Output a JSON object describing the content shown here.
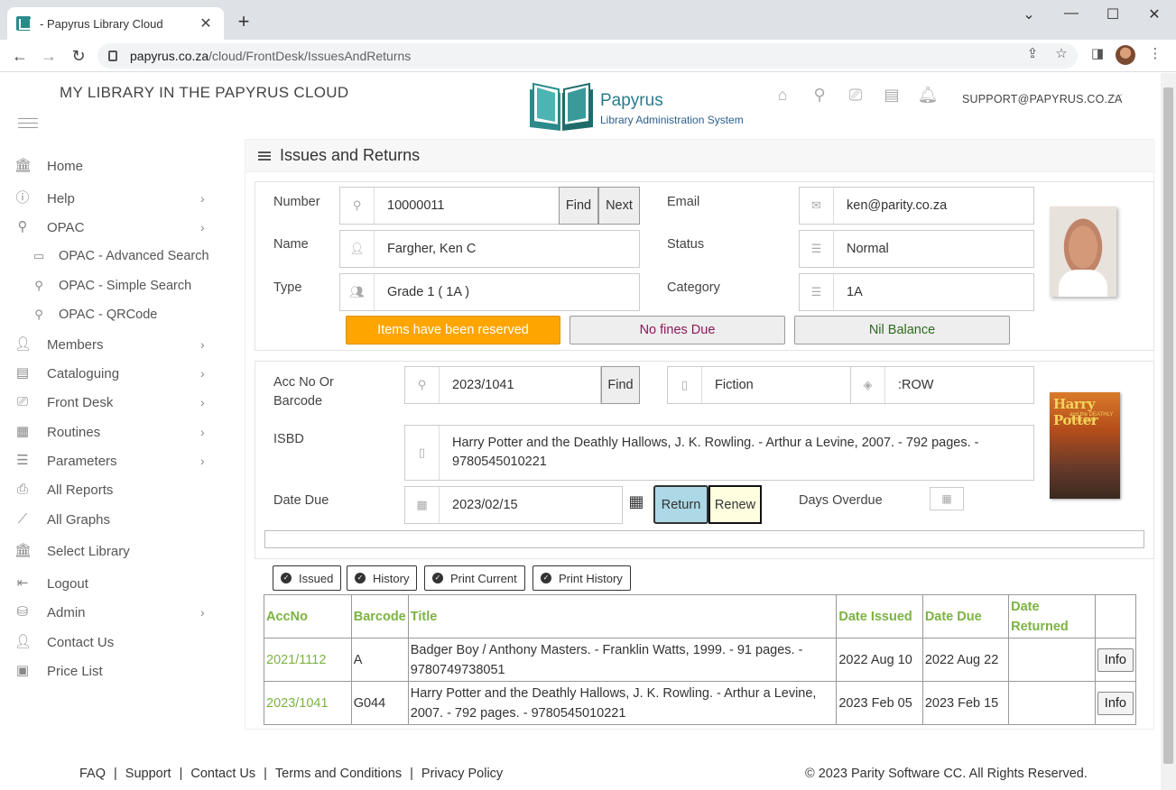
{
  "browser": {
    "tab_title": "- Papyrus Library Cloud",
    "url_host": "papyrus.co.za",
    "url_path": "/cloud/FrontDesk/IssuesAndReturns"
  },
  "header": {
    "site_title": "MY LIBRARY IN THE PAPYRUS CLOUD",
    "logo_name": "Papyrus",
    "logo_tagline": "Library Administration System",
    "user_email": "SUPPORT@PAPYRUS.CO.ZA"
  },
  "sidebar": {
    "items": [
      {
        "label": "Home",
        "icon": "bank-icon"
      },
      {
        "label": "Help",
        "icon": "info-icon"
      },
      {
        "label": "OPAC",
        "icon": "search-icon"
      },
      {
        "label": "OPAC - Advanced Search",
        "icon": "monitor-icon"
      },
      {
        "label": "OPAC - Simple Search",
        "icon": "search-icon"
      },
      {
        "label": "OPAC - QRCode",
        "icon": "search-icon"
      },
      {
        "label": "Members",
        "icon": "users-icon"
      },
      {
        "label": "Cataloguing",
        "icon": "book-icon"
      },
      {
        "label": "Front Desk",
        "icon": "desk-icon"
      },
      {
        "label": "Routines",
        "icon": "calendar-icon"
      },
      {
        "label": "Parameters",
        "icon": "list-icon"
      },
      {
        "label": "All Reports",
        "icon": "printer-icon"
      },
      {
        "label": "All Graphs",
        "icon": "graph-icon"
      },
      {
        "label": "Select Library",
        "icon": "bank-icon"
      },
      {
        "label": "Logout",
        "icon": "logout-icon"
      },
      {
        "label": "Admin",
        "icon": "database-icon"
      },
      {
        "label": "Contact Us",
        "icon": "user-icon"
      },
      {
        "label": "Price List",
        "icon": "wallet-icon"
      }
    ]
  },
  "panel": {
    "title": "Issues and Returns"
  },
  "member": {
    "number_label": "Number",
    "number_value": "10000011",
    "find_label": "Find",
    "next_label": "Next",
    "name_label": "Name",
    "name_value": "Fargher, Ken C",
    "type_label": "Type",
    "type_value": "Grade 1 ( 1A )",
    "email_label": "Email",
    "email_value": "ken@parity.co.za",
    "status_label": "Status",
    "status_value": "Normal",
    "category_label": "Category",
    "category_value": "1A",
    "reserved_label": "Items have been reserved",
    "fines_label": "No fines Due",
    "balance_label": "Nil Balance"
  },
  "item": {
    "acc_label_1": "Acc No Or",
    "acc_label_2": "Barcode",
    "acc_value": "2023/1041",
    "find_label": "Find",
    "genre_value": "Fiction",
    "location_value": ":ROW",
    "isbd_label": "ISBD",
    "isbd_value": "Harry Potter and the Deathly Hallows, J. K. Rowling. - Arthur a Levine, 2007. - 792 pages. - 9780545010221",
    "date_due_label": "Date Due",
    "date_due_value": "2023/02/15",
    "return_label": "Return",
    "renew_label": "Renew",
    "days_overdue_label": "Days Overdue",
    "cover_title": "Harry Potter",
    "cover_subtitle": "and the DEATHLY HALLOWS"
  },
  "view_tabs": [
    "Issued",
    "History",
    "Print Current",
    "Print History"
  ],
  "loans": {
    "columns": [
      "AccNo",
      "Barcode",
      "Title",
      "Date Issued",
      "Date Due",
      "Date Returned",
      ""
    ],
    "info_label": "Info",
    "rows": [
      {
        "accno": "2021/1112",
        "barcode": "A",
        "title": "Badger Boy / Anthony Masters. - Franklin Watts, 1999. - 91 pages. - 9780749738051",
        "issued": "2022 Aug 10",
        "due": "2022 Aug 22",
        "returned": ""
      },
      {
        "accno": "2023/1041",
        "barcode": "G044",
        "title": "Harry Potter and the Deathly Hallows, J. K. Rowling. - Arthur a Levine, 2007. - 792 pages. - 9780545010221",
        "issued": "2023 Feb 05",
        "due": "2023 Feb 15",
        "returned": ""
      }
    ]
  },
  "footer": {
    "links": [
      "FAQ",
      "Support",
      "Contact Us",
      "Terms and Conditions",
      "Privacy Policy"
    ],
    "copyright": "© 2023 Parity Software CC. All Rights Reserved."
  },
  "colors": {
    "accent_green": "#7cb342",
    "reserved_orange": "#ffa500",
    "fines_purple": "#8b1a5a",
    "balance_green": "#2e6b1f",
    "return_blue": "#add8e6",
    "renew_yellow": "#ffffe0"
  }
}
